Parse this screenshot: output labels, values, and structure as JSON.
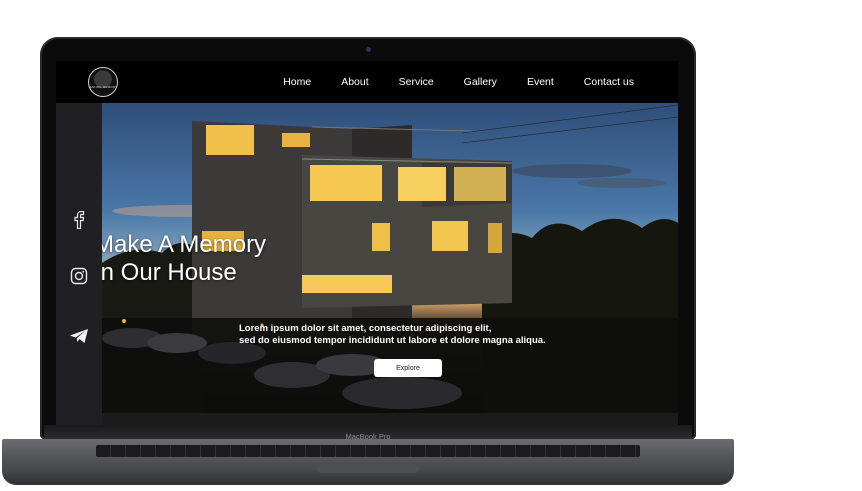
{
  "device": {
    "model_label": "MacBook Pro"
  },
  "nav": {
    "logo_text": "MAKING MEMORY",
    "links": [
      "Home",
      "About",
      "Service",
      "Gallery",
      "Event",
      "Contact us"
    ]
  },
  "social": [
    {
      "icon": "facebook-icon"
    },
    {
      "icon": "instagram-icon"
    },
    {
      "icon": "telegram-icon"
    }
  ],
  "hero": {
    "title_line1": "Make A Memory",
    "title_line2": "In Our House",
    "description_line1": "Lorem ipsum dolor sit amet, consectetur adipiscing elit,",
    "description_line2": "sed do eiusmod tempor incididunt ut labore et dolore magna aliqua.",
    "cta_label": "Explore"
  },
  "colors": {
    "nav_bg": "#000000",
    "sidebar_bg": "#202022",
    "cta_bg": "#ffffff",
    "text": "#ffffff"
  }
}
